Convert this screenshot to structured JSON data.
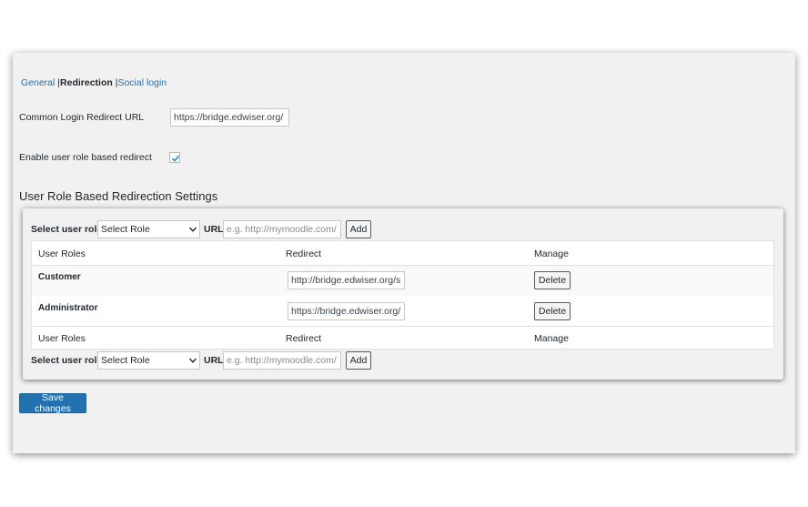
{
  "tabs": [
    {
      "label": "General",
      "active": false
    },
    {
      "label": "Redirection",
      "active": true
    },
    {
      "label": "Social login",
      "active": false
    }
  ],
  "tab_separator": "|",
  "common_redirect": {
    "label": "Common Login Redirect URL",
    "value": "https://bridge.edwiser.org/"
  },
  "role_based": {
    "label": "Enable user role based redirect",
    "checked": true
  },
  "section_title": "User Role Based Redirection Settings",
  "controls": {
    "select_label": "Select user role",
    "select_value": "Select Role",
    "url_label": "URL",
    "url_placeholder": "e.g. http://mymoodle.com/",
    "add_label": "Add"
  },
  "table": {
    "headers": [
      "User Roles",
      "Redirect",
      "Manage"
    ],
    "rows": [
      {
        "role": "Customer",
        "redirect": "http://bridge.edwiser.org/shop",
        "action": "Delete"
      },
      {
        "role": "Administrator",
        "redirect": "https://bridge.edwiser.org/",
        "action": "Delete"
      }
    ]
  },
  "save_label": "Save changes",
  "colors": {
    "accent": "#2271b1",
    "panel_bg": "#f1f1f1",
    "text": "#23282d"
  },
  "icons": {
    "checkmark": "check-icon",
    "select_arrow": "chevron-down-icon"
  }
}
